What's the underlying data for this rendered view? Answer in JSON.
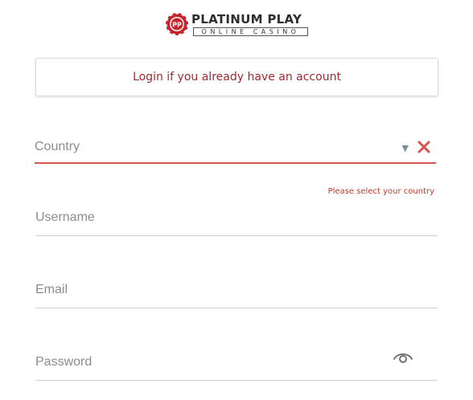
{
  "brand": {
    "title": "PLATINUM PLAY",
    "subtitle": "ONLINE CASINO",
    "chip_text": "PP",
    "colors": {
      "chip_red": "#c8232c",
      "text_dark": "#2e2e2e"
    }
  },
  "login_prompt": {
    "label": "Login if you already have an account",
    "color": "#9e2a2f"
  },
  "form": {
    "country": {
      "placeholder": "Country",
      "value": "",
      "error": "Please select your country",
      "error_color": "#d9534f",
      "arrow_icon": "dropdown-triangle-icon",
      "clear_icon": "close-x-icon"
    },
    "username": {
      "placeholder": "Username",
      "value": ""
    },
    "email": {
      "placeholder": "Email",
      "value": ""
    },
    "password": {
      "placeholder": "Password",
      "value": "",
      "toggle_icon": "eye-icon"
    }
  }
}
